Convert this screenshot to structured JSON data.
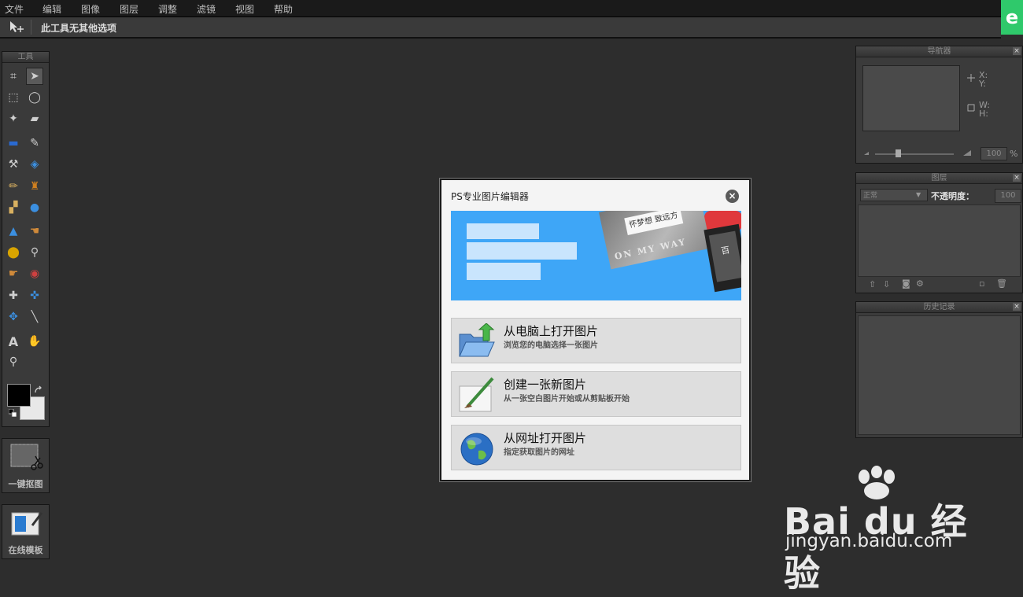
{
  "menu": [
    "文件",
    "编辑",
    "图像",
    "图层",
    "调整",
    "滤镜",
    "视图",
    "帮助"
  ],
  "app_badge": "e",
  "options_bar": {
    "message": "此工具无其他选项"
  },
  "tools_panel": {
    "title": "工具",
    "tools": [
      "crop-icon",
      "move-icon",
      "marquee-icon",
      "lasso-icon",
      "magic-wand-icon",
      "pencil-eraser-icon",
      "gradient-icon",
      "brush-icon",
      "replace-color-icon",
      "paint-bucket-icon",
      "pencil-icon",
      "clone-stamp-icon",
      "shape-icon",
      "blur-icon",
      "sharpen-icon",
      "smudge-icon",
      "sponge-icon",
      "dodge-icon",
      "burn-icon",
      "red-eye-icon",
      "spot-heal-icon",
      "bloat-icon",
      "pinch-icon",
      "color-picker-icon",
      "type-icon",
      "hand-icon",
      "zoom-icon"
    ]
  },
  "side_buttons": {
    "cutout": "一键抠图",
    "templates": "在线模板"
  },
  "navigator": {
    "title": "导航器",
    "x": "X:",
    "y": "Y:",
    "w": "W:",
    "h": "H:",
    "zoom": "100",
    "pct": "%"
  },
  "layers": {
    "title": "图层",
    "blend": "正常",
    "opacity_label": "不透明度：",
    "opacity": "100"
  },
  "history": {
    "title": "历史记录"
  },
  "dialog": {
    "title": "PS专业图片编辑器",
    "close": "×",
    "banner": {
      "card_text": "怀梦想 致远方",
      "card_lower": "ON MY WAY",
      "phone_text": "百"
    },
    "options": [
      {
        "title": "从电脑上打开图片",
        "subtitle": "浏览您的电脑选择一张图片",
        "icon": "folder-open-icon"
      },
      {
        "title": "创建一张新图片",
        "subtitle": "从一张空白图片开始或从剪贴板开始",
        "icon": "paintbrush-canvas-icon"
      },
      {
        "title": "从网址打开图片",
        "subtitle": "指定获取图片的网址",
        "icon": "globe-icon"
      }
    ]
  },
  "watermark": {
    "brand": "Bai du 经验",
    "url": "jingyan.baidu.com"
  }
}
